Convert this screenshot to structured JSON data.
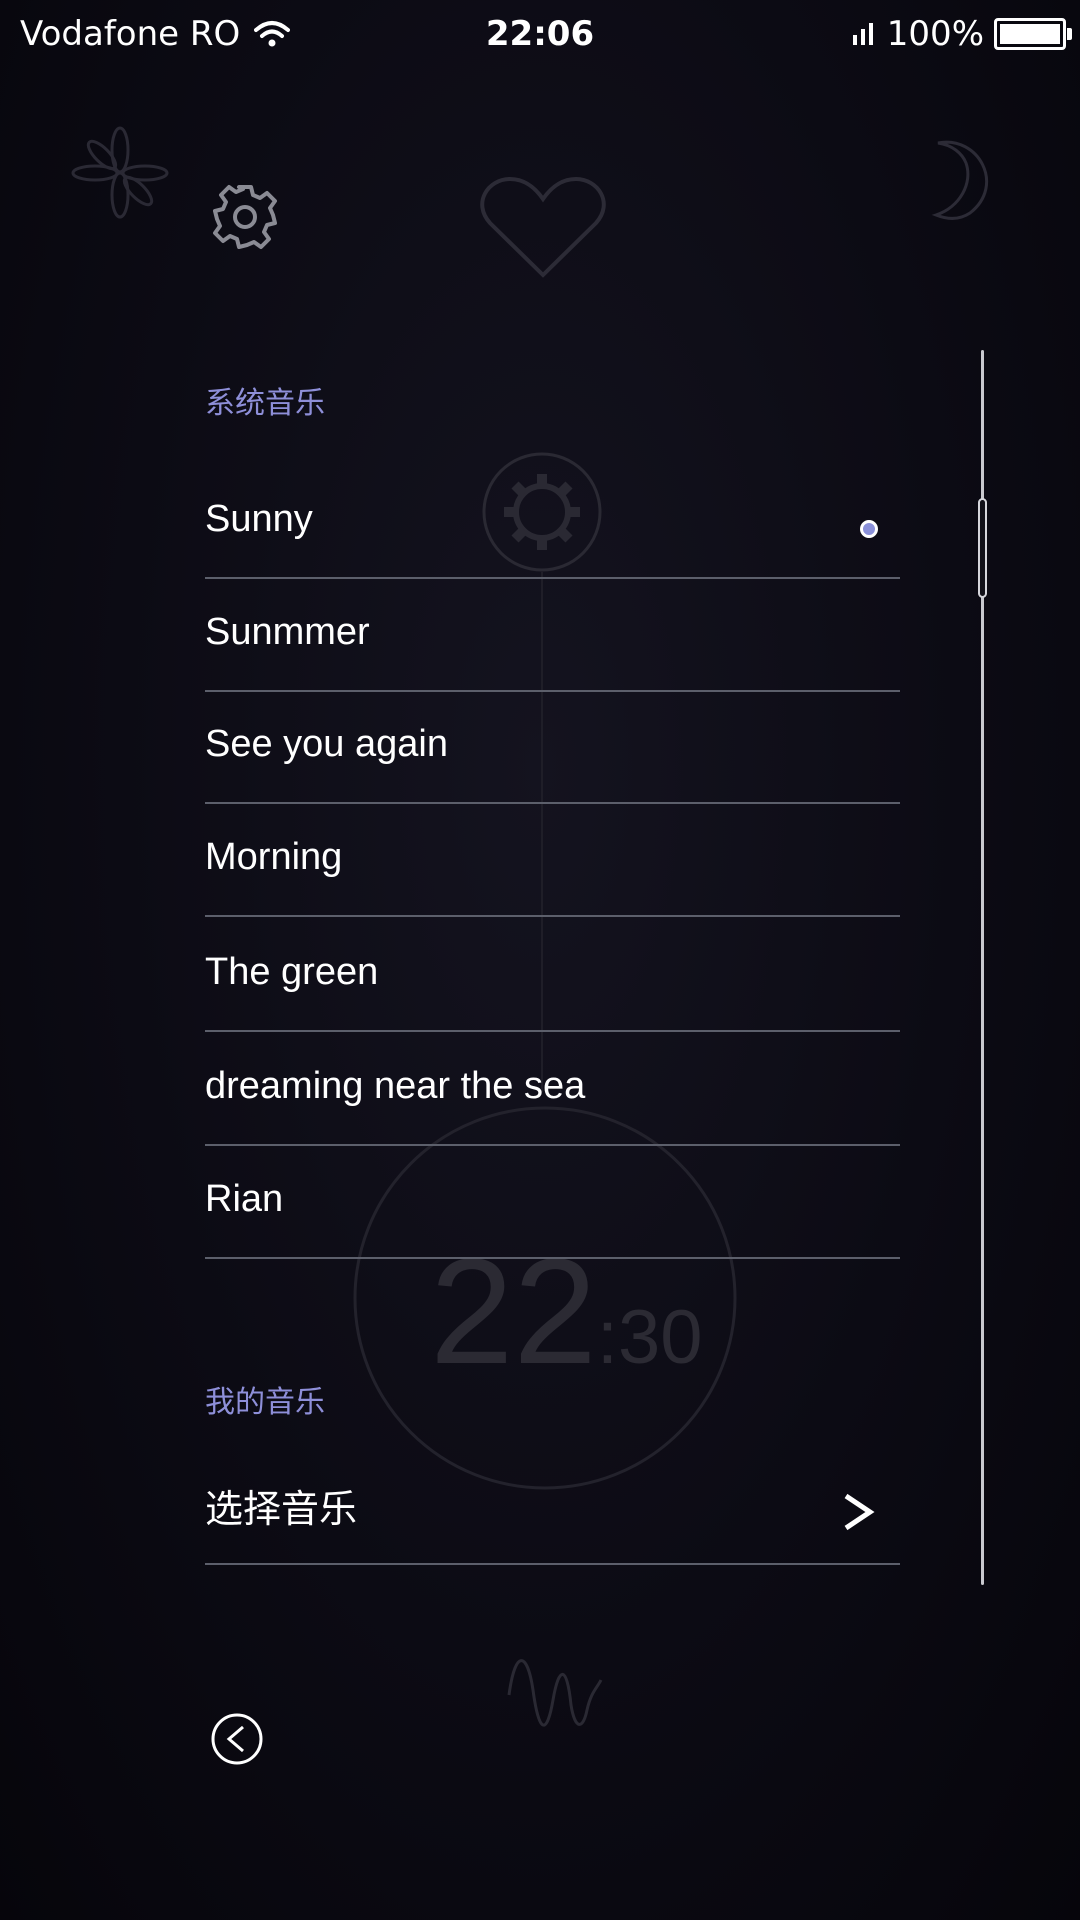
{
  "status_bar": {
    "carrier": "Vodafone RO",
    "time": "22:06",
    "battery": "100%",
    "battery_level": 1.0
  },
  "icons": {
    "settings": "gear-icon",
    "back": "back-arrow-icon",
    "chevron": "chevron-right-icon",
    "wifi": "wifi-icon",
    "signal": "signal-icon"
  },
  "background": {
    "clock_hours": "22",
    "clock_minutes": ":30"
  },
  "sections": {
    "system_music_title": "系统音乐",
    "my_music_title": "我的音乐"
  },
  "songs": [
    {
      "label": "Sunny",
      "selected": true
    },
    {
      "label": "Sunmmer",
      "selected": false
    },
    {
      "label": "See you again",
      "selected": false
    },
    {
      "label": "Morning",
      "selected": false
    },
    {
      "label": "The green",
      "selected": false
    },
    {
      "label": "dreaming near the sea",
      "selected": false
    },
    {
      "label": "Rian",
      "selected": false
    }
  ],
  "choose_music": {
    "label": "选择音乐"
  },
  "colors": {
    "accent": "#8e8fd9",
    "divider": "#5c5f6b",
    "background": "#0c0b14"
  }
}
